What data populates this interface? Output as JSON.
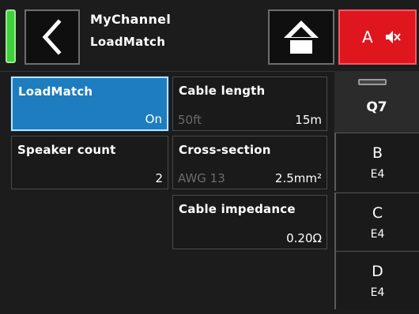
{
  "header": {
    "channel_name": "MyChannel",
    "page_name": "LoadMatch",
    "mute_label": "A"
  },
  "tiles": {
    "loadmatch": {
      "label": "LoadMatch",
      "value": "On"
    },
    "cable_length": {
      "label": "Cable length",
      "alt": "50ft",
      "value": "15m"
    },
    "speaker_count": {
      "label": "Speaker count",
      "value": "2"
    },
    "cross_section": {
      "label": "Cross-section",
      "alt": "AWG 13",
      "value": "2.5mm²"
    },
    "cable_impedance": {
      "label": "Cable impedance",
      "value": "0.20Ω"
    }
  },
  "channels": [
    {
      "name": "Q7",
      "sub": ""
    },
    {
      "name": "B",
      "sub": "E4"
    },
    {
      "name": "C",
      "sub": "E4"
    },
    {
      "name": "D",
      "sub": "E4"
    }
  ],
  "colors": {
    "status_led": "#3fd03a",
    "selected_tile": "#1d7dbf",
    "mute_button": "#e0161f"
  },
  "icons": {
    "back": "chevron-left-icon",
    "home": "home-icon",
    "mute": "speaker-muted-icon"
  }
}
